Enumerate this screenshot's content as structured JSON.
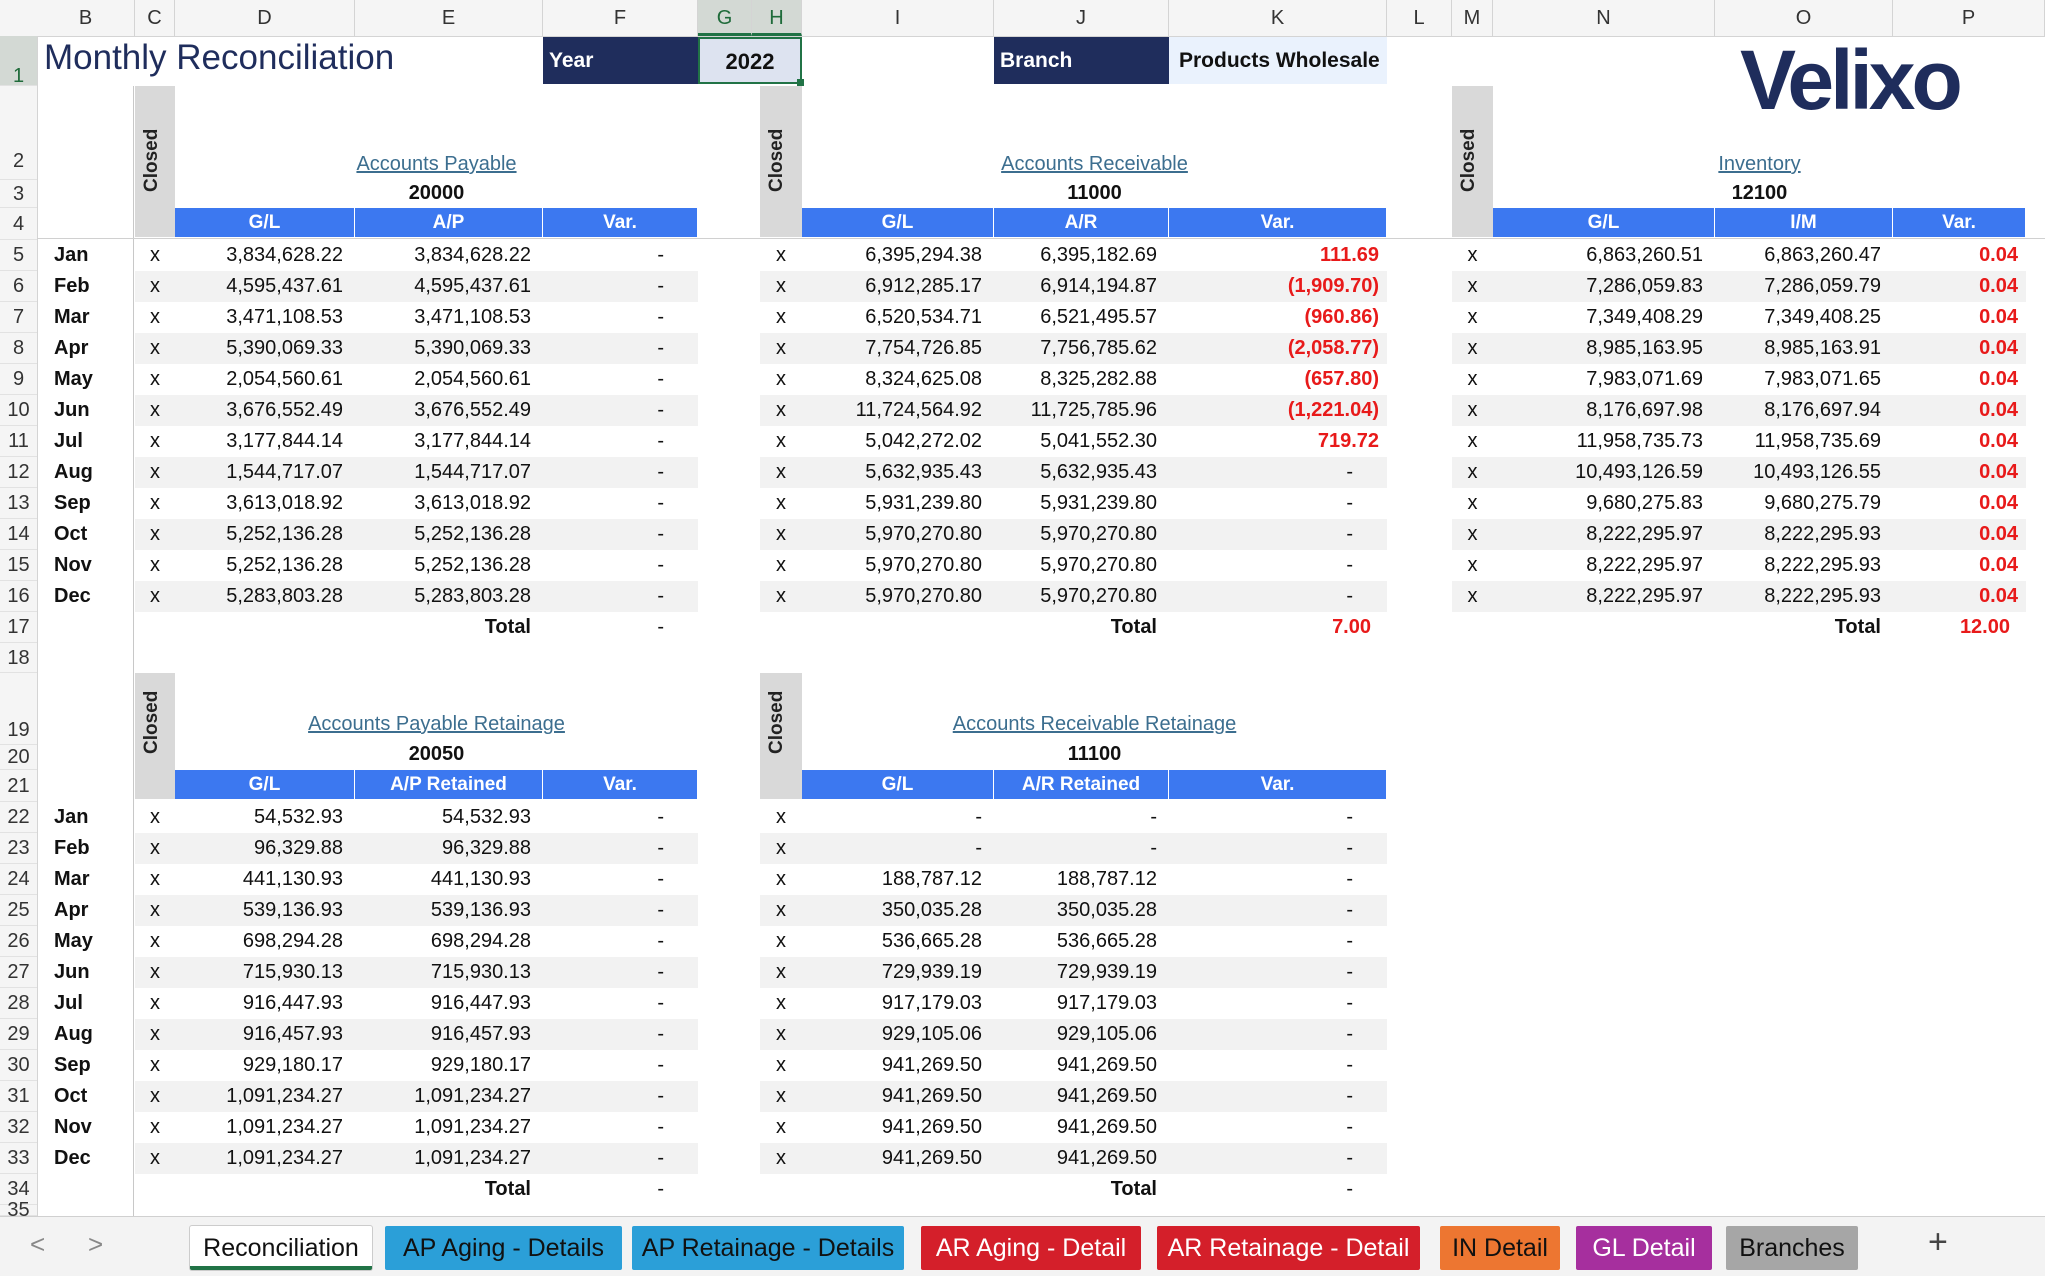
{
  "columns": [
    "B",
    "C",
    "D",
    "E",
    "F",
    "G",
    "H",
    "I",
    "J",
    "K",
    "L",
    "M",
    "N",
    "O",
    "P"
  ],
  "rows": [
    "1",
    "2",
    "3",
    "4",
    "5",
    "6",
    "7",
    "8",
    "9",
    "10",
    "11",
    "12",
    "13",
    "14",
    "15",
    "16",
    "17",
    "18",
    "19",
    "20",
    "21",
    "22",
    "23",
    "24",
    "25",
    "26",
    "27",
    "28",
    "29",
    "30",
    "31",
    "32",
    "33",
    "34",
    "35"
  ],
  "header": {
    "title": "Monthly Reconciliation",
    "year_label": "Year",
    "year_value": "2022",
    "branch_label": "Branch",
    "branch_value": "Products Wholesale",
    "logo": "Velixo"
  },
  "closed_label": "Closed",
  "total_label": "Total",
  "months": [
    "Jan",
    "Feb",
    "Mar",
    "Apr",
    "May",
    "Jun",
    "Jul",
    "Aug",
    "Sep",
    "Oct",
    "Nov",
    "Dec"
  ],
  "sections": {
    "ap": {
      "title": "Accounts Payable",
      "account": "20000",
      "cols": [
        "G/L",
        "A/P",
        "Var."
      ],
      "closed": [
        "x",
        "x",
        "x",
        "x",
        "x",
        "x",
        "x",
        "x",
        "x",
        "x",
        "x",
        "x"
      ],
      "gl": [
        "3,834,628.22",
        "4,595,437.61",
        "3,471,108.53",
        "5,390,069.33",
        "2,054,560.61",
        "3,676,552.49",
        "3,177,844.14",
        "1,544,717.07",
        "3,613,018.92",
        "5,252,136.28",
        "5,252,136.28",
        "5,283,803.28"
      ],
      "sub": [
        "3,834,628.22",
        "4,595,437.61",
        "3,471,108.53",
        "5,390,069.33",
        "2,054,560.61",
        "3,676,552.49",
        "3,177,844.14",
        "1,544,717.07",
        "3,613,018.92",
        "5,252,136.28",
        "5,252,136.28",
        "5,283,803.28"
      ],
      "var": [
        "-",
        "-",
        "-",
        "-",
        "-",
        "-",
        "-",
        "-",
        "-",
        "-",
        "-",
        "-"
      ],
      "total": "-"
    },
    "ar": {
      "title": "Accounts Receivable",
      "account": "11000",
      "cols": [
        "G/L",
        "A/R",
        "Var."
      ],
      "closed": [
        "x",
        "x",
        "x",
        "x",
        "x",
        "x",
        "x",
        "x",
        "x",
        "x",
        "x",
        "x"
      ],
      "gl": [
        "6,395,294.38",
        "6,912,285.17",
        "6,520,534.71",
        "7,754,726.85",
        "8,324,625.08",
        "11,724,564.92",
        "5,042,272.02",
        "5,632,935.43",
        "5,931,239.80",
        "5,970,270.80",
        "5,970,270.80",
        "5,970,270.80"
      ],
      "sub": [
        "6,395,182.69",
        "6,914,194.87",
        "6,521,495.57",
        "7,756,785.62",
        "8,325,282.88",
        "11,725,785.96",
        "5,041,552.30",
        "5,632,935.43",
        "5,931,239.80",
        "5,970,270.80",
        "5,970,270.80",
        "5,970,270.80"
      ],
      "var": [
        "111.69",
        "(1,909.70)",
        "(960.86)",
        "(2,058.77)",
        "(657.80)",
        "(1,221.04)",
        "719.72",
        "-",
        "-",
        "-",
        "-",
        "-"
      ],
      "total": "7.00"
    },
    "inv": {
      "title": "Inventory",
      "account": "12100",
      "cols": [
        "G/L",
        "I/M",
        "Var."
      ],
      "closed": [
        "x",
        "x",
        "x",
        "x",
        "x",
        "x",
        "x",
        "x",
        "x",
        "x",
        "x",
        "x"
      ],
      "gl": [
        "6,863,260.51",
        "7,286,059.83",
        "7,349,408.29",
        "8,985,163.95",
        "7,983,071.69",
        "8,176,697.98",
        "11,958,735.73",
        "10,493,126.59",
        "9,680,275.83",
        "8,222,295.97",
        "8,222,295.97",
        "8,222,295.97"
      ],
      "sub": [
        "6,863,260.47",
        "7,286,059.79",
        "7,349,408.25",
        "8,985,163.91",
        "7,983,071.65",
        "8,176,697.94",
        "11,958,735.69",
        "10,493,126.55",
        "9,680,275.79",
        "8,222,295.93",
        "8,222,295.93",
        "8,222,295.93"
      ],
      "var": [
        "0.04",
        "0.04",
        "0.04",
        "0.04",
        "0.04",
        "0.04",
        "0.04",
        "0.04",
        "0.04",
        "0.04",
        "0.04",
        "0.04"
      ],
      "total": "12.00"
    },
    "apr": {
      "title": "Accounts Payable Retainage",
      "account": "20050",
      "cols": [
        "G/L",
        "A/P Retained",
        "Var."
      ],
      "closed": [
        "x",
        "x",
        "x",
        "x",
        "x",
        "x",
        "x",
        "x",
        "x",
        "x",
        "x",
        "x"
      ],
      "gl": [
        "54,532.93",
        "96,329.88",
        "441,130.93",
        "539,136.93",
        "698,294.28",
        "715,930.13",
        "916,447.93",
        "916,457.93",
        "929,180.17",
        "1,091,234.27",
        "1,091,234.27",
        "1,091,234.27"
      ],
      "sub": [
        "54,532.93",
        "96,329.88",
        "441,130.93",
        "539,136.93",
        "698,294.28",
        "715,930.13",
        "916,447.93",
        "916,457.93",
        "929,180.17",
        "1,091,234.27",
        "1,091,234.27",
        "1,091,234.27"
      ],
      "var": [
        "-",
        "-",
        "-",
        "-",
        "-",
        "-",
        "-",
        "-",
        "-",
        "-",
        "-",
        "-"
      ],
      "total": "-"
    },
    "arr": {
      "title": "Accounts Receivable Retainage",
      "account": "11100",
      "cols": [
        "G/L",
        "A/R Retained",
        "Var."
      ],
      "closed": [
        "x",
        "x",
        "x",
        "x",
        "x",
        "x",
        "x",
        "x",
        "x",
        "x",
        "x",
        "x"
      ],
      "gl": [
        "-",
        "-",
        "188,787.12",
        "350,035.28",
        "536,665.28",
        "729,939.19",
        "917,179.03",
        "929,105.06",
        "941,269.50",
        "941,269.50",
        "941,269.50",
        "941,269.50"
      ],
      "sub": [
        "-",
        "-",
        "188,787.12",
        "350,035.28",
        "536,665.28",
        "729,939.19",
        "917,179.03",
        "929,105.06",
        "941,269.50",
        "941,269.50",
        "941,269.50",
        "941,269.50"
      ],
      "var": [
        "-",
        "-",
        "-",
        "-",
        "-",
        "-",
        "-",
        "-",
        "-",
        "-",
        "-",
        "-"
      ],
      "total": "-"
    }
  },
  "tabs": {
    "prev": "<",
    "next": ">",
    "add": "+",
    "items": [
      {
        "label": "Reconciliation",
        "color": "#ffffff",
        "text": "#111111",
        "active": true
      },
      {
        "label": "AP Aging - Details",
        "color": "#2b9fd8",
        "text": "#111111"
      },
      {
        "label": "AP Retainage - Details",
        "color": "#2b9fd8",
        "text": "#111111"
      },
      {
        "label": "AR Aging - Detail",
        "color": "#d41f2a",
        "text": "#ffffff"
      },
      {
        "label": "AR Retainage - Detail",
        "color": "#d41f2a",
        "text": "#ffffff"
      },
      {
        "label": "IN Detail",
        "color": "#ed7631",
        "text": "#111111"
      },
      {
        "label": "GL Detail",
        "color": "#a62f9e",
        "text": "#ffffff"
      },
      {
        "label": "Branches",
        "color": "#a6a6a6",
        "text": "#111111"
      }
    ]
  }
}
